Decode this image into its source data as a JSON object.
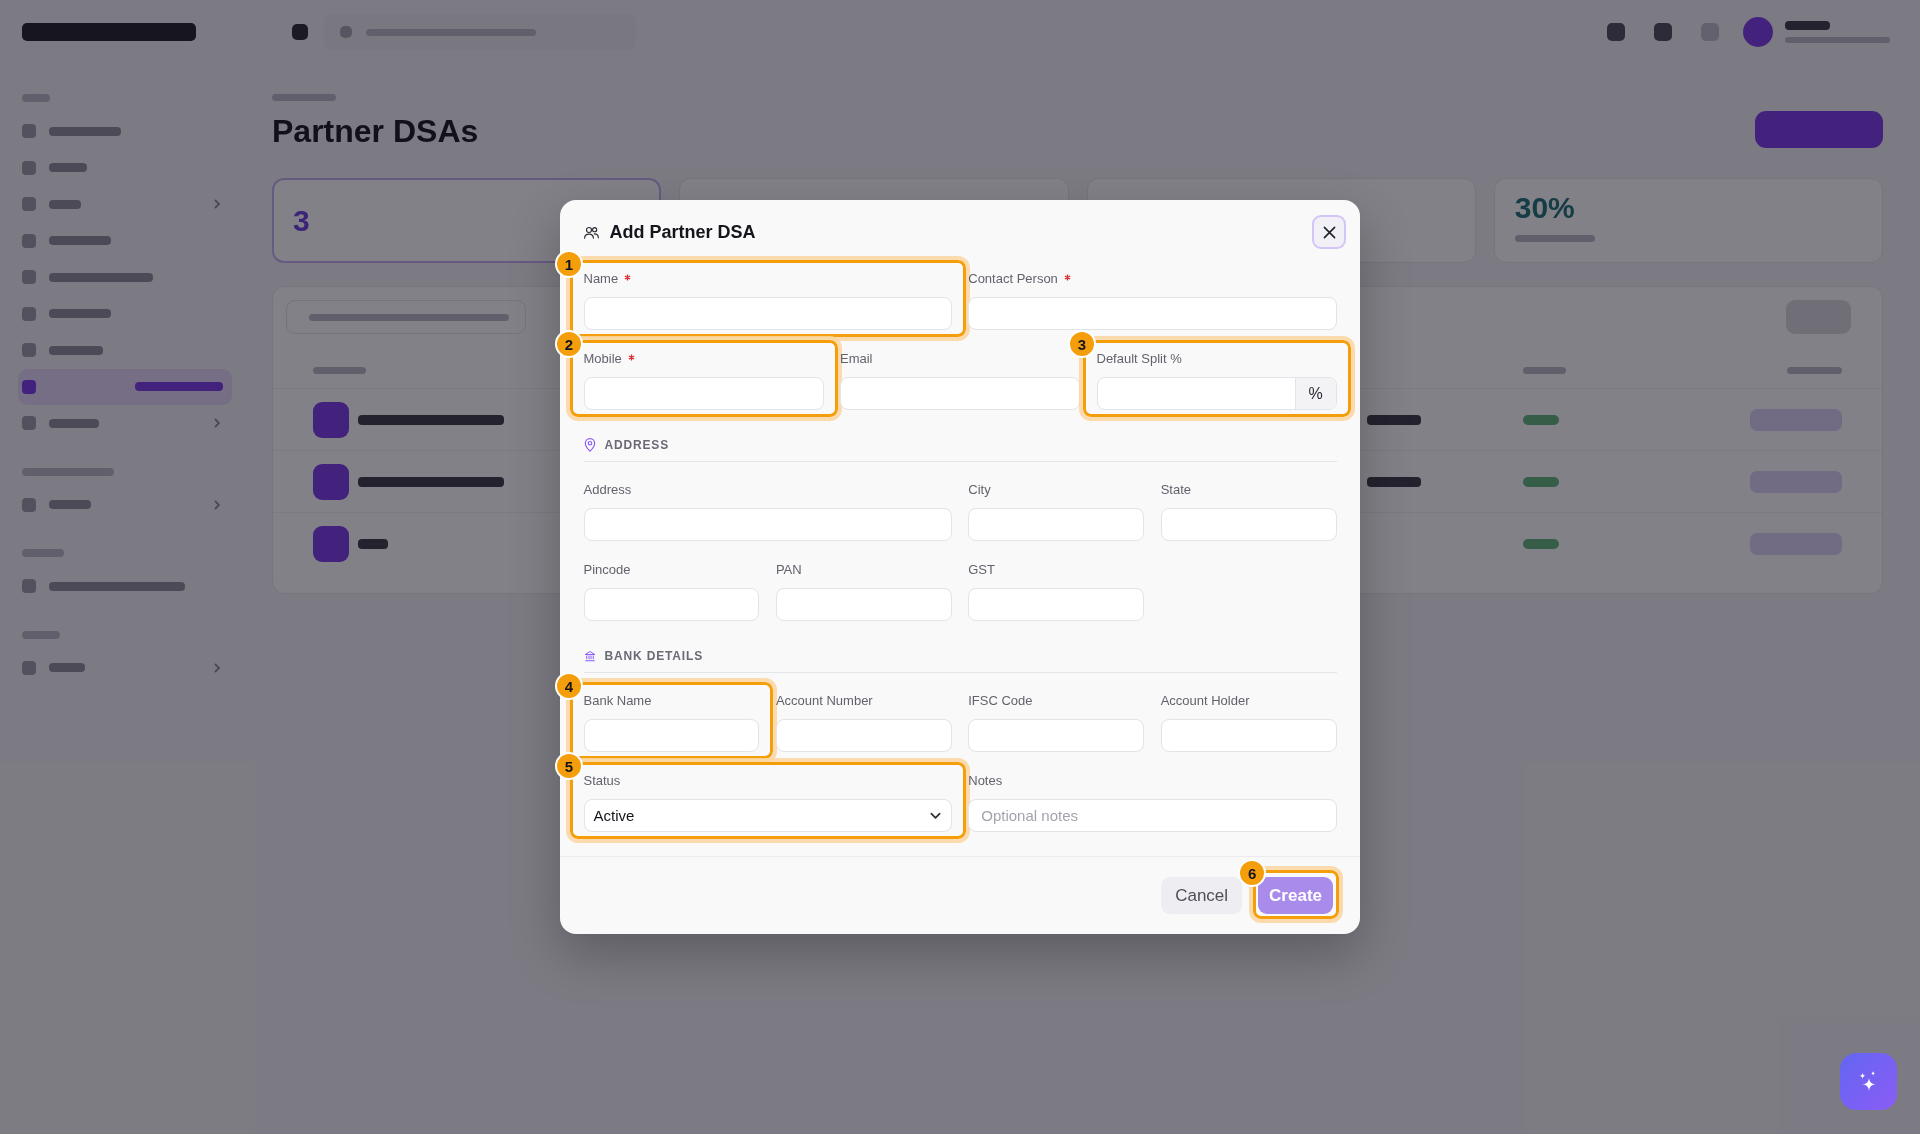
{
  "app": {
    "sidebar": {
      "sections": [
        {
          "items": [
            {
              "selected": false,
              "expandable": false
            },
            {
              "selected": false,
              "expandable": false
            },
            {
              "selected": false,
              "expandable": true
            },
            {
              "selected": false,
              "expandable": false
            },
            {
              "selected": false,
              "expandable": false
            },
            {
              "selected": false,
              "expandable": false
            },
            {
              "selected": false,
              "expandable": false
            },
            {
              "selected": true,
              "expandable": false
            },
            {
              "selected": false,
              "expandable": true
            }
          ]
        },
        {
          "items": [
            {
              "selected": false,
              "expandable": true
            }
          ]
        },
        {
          "items": [
            {
              "selected": false,
              "expandable": false
            }
          ]
        },
        {
          "items": [
            {
              "selected": false,
              "expandable": true
            }
          ]
        }
      ]
    },
    "page": {
      "title": "Partner DSAs",
      "stat_cards": [
        {
          "value": "3",
          "selected": true
        },
        {
          "selected": false
        },
        {
          "selected": false
        },
        {
          "value": "30%",
          "selected": false
        }
      ]
    }
  },
  "dialog": {
    "title": "Add Partner DSA",
    "sections": [
      {
        "rows": [
          {
            "fields": [
              {
                "kind": "text",
                "label": "Name",
                "required": true,
                "callout": "1"
              },
              {
                "kind": "text",
                "label": "Contact Person",
                "required": true
              }
            ]
          },
          {
            "fields": [
              {
                "kind": "text",
                "label": "Mobile",
                "required": true,
                "callout": "2"
              },
              {
                "kind": "text",
                "label": "Email",
                "required": false
              },
              {
                "kind": "suffix",
                "label": "Default Split %",
                "required": false,
                "suffix": "%",
                "callout": "3"
              }
            ]
          }
        ]
      },
      {
        "kind": "address",
        "heading": "ADDRESS",
        "rows": [
          {
            "fields": [
              {
                "kind": "text",
                "label": "Address",
                "required": false
              },
              {
                "kind": "text",
                "label": "City",
                "required": false
              },
              {
                "kind": "text",
                "label": "State",
                "required": false
              }
            ]
          },
          {
            "fields": [
              {
                "kind": "text",
                "label": "Pincode",
                "required": false
              },
              {
                "kind": "text",
                "label": "PAN",
                "required": false
              },
              {
                "kind": "text",
                "label": "GST",
                "required": false
              }
            ]
          }
        ]
      },
      {
        "kind": "bank",
        "heading": "BANK DETAILS",
        "rows": [
          {
            "fields": [
              {
                "kind": "text",
                "label": "Bank Name",
                "required": false,
                "callout": "4"
              },
              {
                "kind": "text",
                "label": "Account Number",
                "required": false
              },
              {
                "kind": "text",
                "label": "IFSC Code",
                "required": false
              },
              {
                "kind": "text",
                "label": "Account Holder",
                "required": false
              }
            ]
          },
          {
            "fields": [
              {
                "kind": "select",
                "label": "Status",
                "required": false,
                "value": "Active",
                "callout": "5"
              },
              {
                "kind": "text",
                "label": "Notes",
                "required": false,
                "placeholder": "Optional notes"
              }
            ]
          }
        ]
      }
    ],
    "buttons": [
      {
        "kind": "secondary",
        "label": "Cancel",
        "disabled": false
      },
      {
        "kind": "primary",
        "label": "Create",
        "disabled": true,
        "callout": "6"
      }
    ]
  }
}
